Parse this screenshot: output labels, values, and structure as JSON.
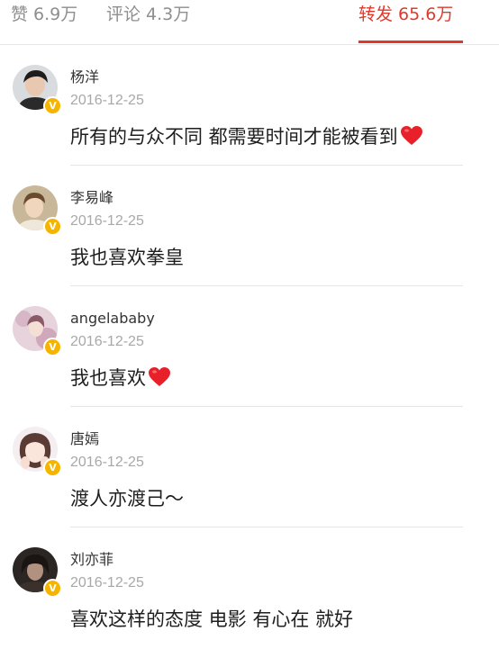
{
  "tabs": {
    "likes": "赞 6.9万",
    "comments": "评论 4.3万",
    "reposts": "转发 65.6万",
    "active_color": "#e0392b"
  },
  "verified_badge": "V",
  "reposts": [
    {
      "name": "杨洋",
      "date": "2016-12-25",
      "text": "所有的与众不同 都需要时间才能被看到",
      "emoji": "red-heart"
    },
    {
      "name": "李易峰",
      "date": "2016-12-25",
      "text": "我也喜欢拳皇",
      "emoji": ""
    },
    {
      "name": "angelababy",
      "date": "2016-12-25",
      "text": "我也喜欢",
      "emoji": "red-heart"
    },
    {
      "name": "唐嫣",
      "date": "2016-12-25",
      "text": "渡人亦渡己～",
      "emoji": ""
    },
    {
      "name": "刘亦菲",
      "date": "2016-12-25",
      "text": "喜欢这样的态度 电影 有心在 就好",
      "emoji": ""
    }
  ]
}
